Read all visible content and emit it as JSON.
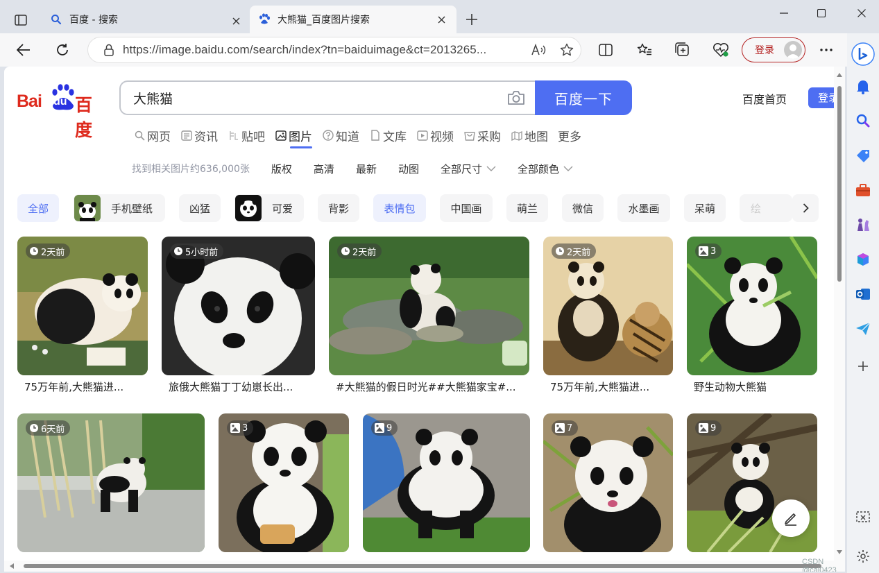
{
  "tabs": [
    {
      "title": "百度 - 搜索",
      "active": false
    },
    {
      "title": "大熊猫_百度图片搜索",
      "active": true
    }
  ],
  "toolbar": {
    "url": "https://image.baidu.com/search/index?tn=baiduimage&ct=2013265...",
    "login_label": "登录"
  },
  "page": {
    "logo_latin": "Bai",
    "logo_du": "du",
    "logo_cn": "百度",
    "query": "大熊猫",
    "search_button": "百度一下",
    "home_link": "百度首页",
    "top_login": "登录",
    "nav": [
      {
        "label": "网页",
        "icon": "search-icon"
      },
      {
        "label": "资讯",
        "icon": "news-icon"
      },
      {
        "label": "贴吧",
        "icon": "tieba-icon"
      },
      {
        "label": "图片",
        "icon": "image-icon",
        "active": true
      },
      {
        "label": "知道",
        "icon": "question-icon"
      },
      {
        "label": "文库",
        "icon": "doc-icon"
      },
      {
        "label": "视频",
        "icon": "video-icon"
      },
      {
        "label": "采购",
        "icon": "cart-icon"
      },
      {
        "label": "地图",
        "icon": "map-icon"
      },
      {
        "label": "更多",
        "icon": ""
      }
    ],
    "result_count": "找到相关图片约636,000张",
    "filters": [
      "版权",
      "高清",
      "最新",
      "动图",
      "全部尺寸",
      "全部颜色"
    ],
    "chips": [
      "全部",
      "手机壁纸",
      "凶猛",
      "可爱",
      "背影",
      "表情包",
      "中国画",
      "萌兰",
      "微信",
      "水墨画",
      "呆萌",
      "绘"
    ],
    "cards": [
      {
        "badge": "2天前",
        "badge_type": "clock",
        "caption": "75万年前,大熊猫进..."
      },
      {
        "badge": "5小时前",
        "badge_type": "clock",
        "caption": "旅俄大熊猫丁丁幼崽长出..."
      },
      {
        "badge": "2天前",
        "badge_type": "clock",
        "caption": "#大熊猫的假日时光##大熊猫家宝#..."
      },
      {
        "badge": "2天前",
        "badge_type": "clock",
        "caption": "75万年前,大熊猫进..."
      },
      {
        "badge": "3",
        "badge_type": "album",
        "caption": "野生动物大熊猫"
      },
      {
        "badge": "6天前",
        "badge_type": "clock",
        "caption": ""
      },
      {
        "badge": "3",
        "badge_type": "album",
        "caption": ""
      },
      {
        "badge": "9",
        "badge_type": "album",
        "caption": ""
      },
      {
        "badge": "7",
        "badge_type": "album",
        "caption": ""
      },
      {
        "badge": "9",
        "badge_type": "album",
        "caption": ""
      }
    ],
    "watermark": "CSDN @cal0423"
  },
  "colors": {
    "baidu_blue": "#4e6ef2",
    "baidu_red": "#de2a1d",
    "login_red": "#b32020"
  }
}
